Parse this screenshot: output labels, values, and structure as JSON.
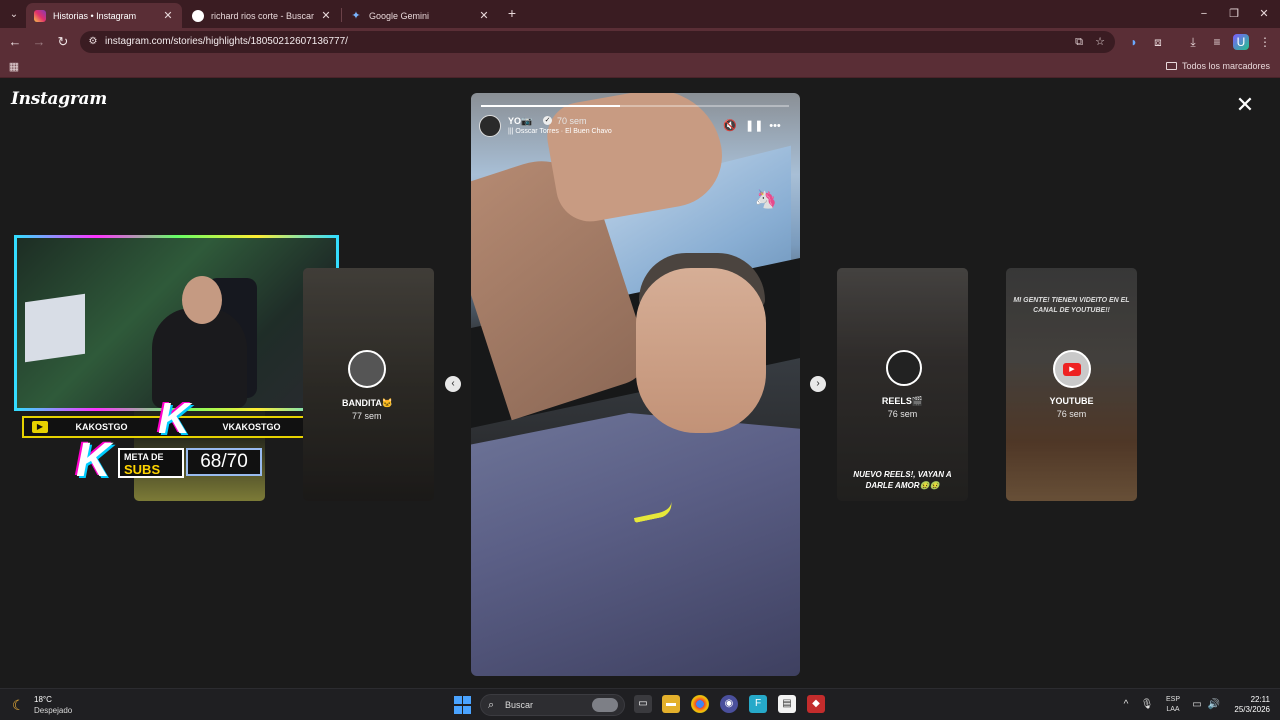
{
  "browser": {
    "tabs": [
      {
        "label": "Historias • Instagram",
        "icon": "instagram-icon",
        "active": true
      },
      {
        "label": "richard rios corte - Buscar con Google",
        "icon": "google-icon",
        "active": false
      },
      {
        "label": "Google Gemini",
        "icon": "gemini-icon",
        "active": false
      }
    ],
    "new_tab": "+",
    "window_controls": [
      "−",
      "❐",
      "✕"
    ],
    "url": "instagram.com/stories/highlights/18050212607136777/",
    "bookmarks_label": "Todos los marcadores"
  },
  "instagram": {
    "logo": "Instagram",
    "close": "✕",
    "left_previews": [
      {
        "name": "",
        "time": ""
      },
      {
        "name": "BANDITA🐱",
        "time": "77 sem"
      }
    ],
    "stream_overlay": {
      "left_channel": "KAKOSTGO",
      "right_channel": "VKAKOSTGO",
      "logo_letter": "K",
      "meta_label_1": "META DE",
      "meta_label_2": "SUBS",
      "count": "68/70"
    },
    "story": {
      "progress_fraction": 0.45,
      "user": "YO📷",
      "verified": "✓",
      "time": "70 sem",
      "music": "Osscar Torres · El Buen Chavo",
      "music_prefix": "|||"
    },
    "right_previews": [
      {
        "name": "REELS🎬",
        "time": "76 sem",
        "caption": "NUEVO REELS!, VAYAN A DARLE AMOR🤢🤢"
      },
      {
        "name": "YOUTUBE",
        "time": "76 sem",
        "top_caption": "MI GENTE! TIENEN VIDEITO EN EL CANAL DE YOUTUBE!!"
      }
    ],
    "prev_arrow": "‹",
    "next_arrow": "›"
  },
  "taskbar": {
    "weather_temp": "18°C",
    "weather_desc": "Despejado",
    "search_label": "Buscar",
    "lang_1": "ESP",
    "lang_2": "LAA",
    "time": "22:11",
    "date": "25/3/2026"
  },
  "colors": {
    "tabbar": "#3a1c22",
    "toolbar": "#5a2e36",
    "viewer_bg": "#1b1b1b",
    "taskbar": "#1f1f22"
  }
}
